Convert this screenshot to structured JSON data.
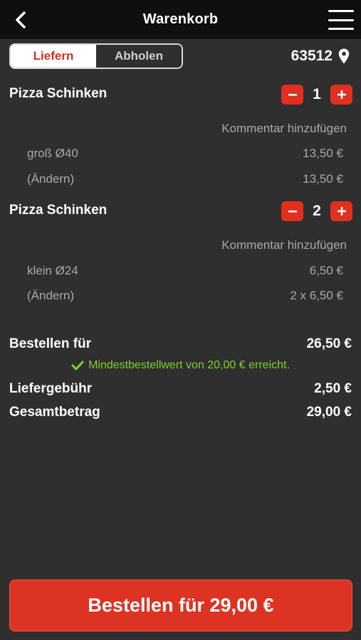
{
  "header": {
    "title": "Warenkorb",
    "back_icon": "chevron-left-icon",
    "menu_icon": "hamburger-menu-icon"
  },
  "mode": {
    "delivery_label": "Liefern",
    "pickup_label": "Abholen",
    "selected": "Liefern"
  },
  "location": {
    "zip": "63512",
    "icon": "location-pin-icon"
  },
  "cart": {
    "items": [
      {
        "name": "Pizza Schinken",
        "quantity": "1",
        "comment_label": "Kommentar hinzufügen",
        "size_label": "groß Ø40",
        "size_price": "13,50 €",
        "change_label": "(Ändern)",
        "line_total": "13,50 €"
      },
      {
        "name": "Pizza Schinken",
        "quantity": "2",
        "comment_label": "Kommentar hinzufügen",
        "size_label": "klein Ø24",
        "size_price": "6,50 €",
        "change_label": "(Ändern)",
        "line_total": "2 x 6,50 €"
      }
    ]
  },
  "summary": {
    "subtotal_label": "Bestellen für",
    "subtotal_value": "26,50 €",
    "min_order_note": "Mindestbestellwert von 20,00 € erreicht.",
    "delivery_fee_label": "Liefergebühr",
    "delivery_fee_value": "2,50 €",
    "total_label": "Gesamtbetrag",
    "total_value": "29,00 €"
  },
  "order_button": {
    "label": "Bestellen für 29,00 €"
  },
  "colors": {
    "accent_red": "#dd3322",
    "success_green": "#7fd12d",
    "background": "#2f2f2f",
    "header_bg": "#0f0f0f"
  }
}
